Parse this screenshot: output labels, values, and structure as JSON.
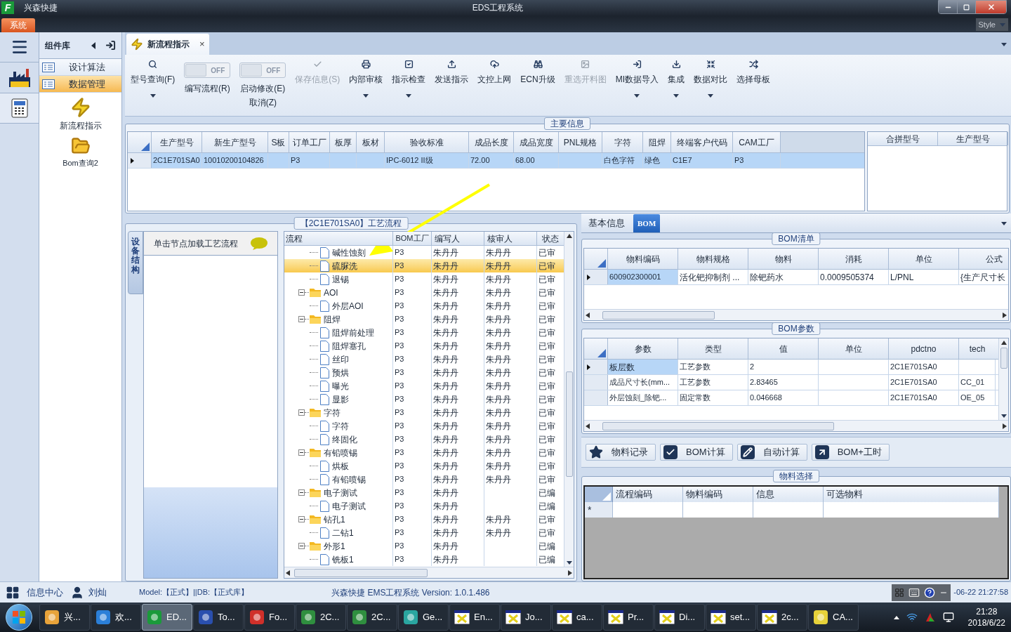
{
  "app": {
    "logo": "F",
    "name": "兴森快捷",
    "title": "EDS工程系统",
    "menu_tab": "系统",
    "style_label": "Style"
  },
  "sidebar": {
    "title": "组件库",
    "items": [
      {
        "label": "设计算法",
        "selected": false
      },
      {
        "label": "数据管理",
        "selected": true
      }
    ],
    "shortcuts": [
      {
        "label": "新流程指示"
      },
      {
        "label": "Bom查询2"
      }
    ]
  },
  "document_tab": {
    "label": "新流程指示",
    "close": "×",
    "selected": true
  },
  "toolbar": [
    {
      "kind": "button",
      "label": "型号查询(F)",
      "dropdown": true,
      "disabled": false
    },
    {
      "kind": "toggle",
      "switch_text": "OFF",
      "on": false,
      "label": "编写流程(R)"
    },
    {
      "kind": "toggle",
      "switch_text": "OFF",
      "on": false,
      "label": "启动修改(E)",
      "label_2": "取消(Z)"
    },
    {
      "kind": "button",
      "label": "保存信息(S)",
      "dropdown": false,
      "disabled": true
    },
    {
      "kind": "button",
      "label": "内部审核",
      "dropdown": true,
      "disabled": false
    },
    {
      "kind": "button",
      "label": "指示检查",
      "dropdown": true,
      "disabled": false
    },
    {
      "kind": "button",
      "label": "发送指示",
      "dropdown": false,
      "disabled": false
    },
    {
      "kind": "button",
      "label": "文控上网",
      "dropdown": false,
      "disabled": false
    },
    {
      "kind": "button",
      "label": "ECN升级",
      "dropdown": false,
      "disabled": false
    },
    {
      "kind": "button",
      "label": "重选开料图",
      "dropdown": false,
      "disabled": true
    },
    {
      "kind": "button",
      "label": "MI数据导入",
      "dropdown": true,
      "disabled": false
    },
    {
      "kind": "button",
      "label": "集成",
      "dropdown": true,
      "disabled": false
    },
    {
      "kind": "button",
      "label": "数据对比",
      "dropdown": true,
      "disabled": false
    },
    {
      "kind": "button",
      "label": "选择母板",
      "dropdown": false,
      "disabled": false
    }
  ],
  "main_info": {
    "title": "主要信息",
    "columns": [
      "生产型号",
      "新生产型号",
      "S板",
      "订单工厂",
      "板厚",
      "板材",
      "验收标准",
      "成品长度",
      "成品宽度",
      "PNL规格",
      "字符",
      "阻焊",
      "终端客户代码",
      "CAM工厂"
    ],
    "rows": [
      {
        "selected": true,
        "cells": [
          "2C1E701SA0",
          "10010200104826",
          "",
          "P3",
          "",
          "",
          "IPC-6012 II级",
          "72.00",
          "68.00",
          "",
          "白色字符",
          "绿色",
          "C1E7",
          "P3"
        ]
      }
    ],
    "side_columns": [
      "合拼型号",
      "生产型号"
    ]
  },
  "process_flow": {
    "title": "【2C1E701SA0】工艺流程",
    "side_tab": "设备结构",
    "panel_title": "单击节点加载工艺流程",
    "columns": [
      "流程",
      "BOM工厂",
      "编写人",
      "核审人",
      "状态"
    ],
    "tree": [
      {
        "kind": "file",
        "name": "碱性蚀刻",
        "factory": "P3",
        "writer": "朱丹丹",
        "reviewer": "朱丹丹",
        "status": "已审",
        "selected": false
      },
      {
        "kind": "file",
        "name": "硫脲洗",
        "factory": "P3",
        "writer": "朱丹丹",
        "reviewer": "朱丹丹",
        "status": "已审",
        "selected": true
      },
      {
        "kind": "file",
        "name": "退锡",
        "factory": "P3",
        "writer": "朱丹丹",
        "reviewer": "朱丹丹",
        "status": "已审",
        "selected": false
      },
      {
        "kind": "folder",
        "name": "AOI",
        "factory": "P3",
        "writer": "朱丹丹",
        "reviewer": "朱丹丹",
        "status": "已审",
        "selected": false,
        "expanded": true,
        "children": [
          {
            "kind": "file",
            "name": "外层AOI",
            "factory": "P3",
            "writer": "朱丹丹",
            "reviewer": "朱丹丹",
            "status": "已审",
            "selected": false
          }
        ]
      },
      {
        "kind": "folder",
        "name": "阻焊",
        "factory": "P3",
        "writer": "朱丹丹",
        "reviewer": "朱丹丹",
        "status": "已审",
        "selected": false,
        "expanded": true,
        "children": [
          {
            "kind": "file",
            "name": "阻焊前处理",
            "factory": "P3",
            "writer": "朱丹丹",
            "reviewer": "朱丹丹",
            "status": "已审",
            "selected": false
          },
          {
            "kind": "file",
            "name": "阻焊塞孔",
            "factory": "P3",
            "writer": "朱丹丹",
            "reviewer": "朱丹丹",
            "status": "已审",
            "selected": false
          },
          {
            "kind": "file",
            "name": "丝印",
            "factory": "P3",
            "writer": "朱丹丹",
            "reviewer": "朱丹丹",
            "status": "已审",
            "selected": false
          },
          {
            "kind": "file",
            "name": "预烘",
            "factory": "P3",
            "writer": "朱丹丹",
            "reviewer": "朱丹丹",
            "status": "已审",
            "selected": false
          },
          {
            "kind": "file",
            "name": "曝光",
            "factory": "P3",
            "writer": "朱丹丹",
            "reviewer": "朱丹丹",
            "status": "已审",
            "selected": false
          },
          {
            "kind": "file",
            "name": "显影",
            "factory": "P3",
            "writer": "朱丹丹",
            "reviewer": "朱丹丹",
            "status": "已审",
            "selected": false
          }
        ]
      },
      {
        "kind": "folder",
        "name": "字符",
        "factory": "P3",
        "writer": "朱丹丹",
        "reviewer": "朱丹丹",
        "status": "已审",
        "selected": false,
        "expanded": true,
        "children": [
          {
            "kind": "file",
            "name": "字符",
            "factory": "P3",
            "writer": "朱丹丹",
            "reviewer": "朱丹丹",
            "status": "已审",
            "selected": false
          },
          {
            "kind": "file",
            "name": "终固化",
            "factory": "P3",
            "writer": "朱丹丹",
            "reviewer": "朱丹丹",
            "status": "已审",
            "selected": false
          }
        ]
      },
      {
        "kind": "folder",
        "name": "有铅喷锡",
        "factory": "P3",
        "writer": "朱丹丹",
        "reviewer": "朱丹丹",
        "status": "已审",
        "selected": false,
        "expanded": true,
        "children": [
          {
            "kind": "file",
            "name": "烘板",
            "factory": "P3",
            "writer": "朱丹丹",
            "reviewer": "朱丹丹",
            "status": "已审",
            "selected": false
          },
          {
            "kind": "file",
            "name": "有铅喷锡",
            "factory": "P3",
            "writer": "朱丹丹",
            "reviewer": "朱丹丹",
            "status": "已审",
            "selected": false
          }
        ]
      },
      {
        "kind": "folder",
        "name": "电子测试",
        "factory": "P3",
        "writer": "朱丹丹",
        "status": "已编",
        "selected": false,
        "expanded": true,
        "children": [
          {
            "kind": "file",
            "name": "电子测试",
            "factory": "P3",
            "writer": "朱丹丹",
            "status": "已编",
            "selected": false
          }
        ]
      },
      {
        "kind": "folder",
        "name": "钻孔1",
        "factory": "P3",
        "writer": "朱丹丹",
        "reviewer": "朱丹丹",
        "status": "已审",
        "selected": false,
        "expanded": true,
        "children": [
          {
            "kind": "file",
            "name": "二钻1",
            "factory": "P3",
            "writer": "朱丹丹",
            "reviewer": "朱丹丹",
            "status": "已审",
            "selected": false
          }
        ]
      },
      {
        "kind": "folder",
        "name": "外形1",
        "factory": "P3",
        "writer": "朱丹丹",
        "status": "已编",
        "selected": false,
        "expanded": true,
        "children": [
          {
            "kind": "file",
            "name": "铣板1",
            "factory": "P3",
            "writer": "朱丹丹",
            "status": "已编",
            "selected": false
          }
        ]
      }
    ]
  },
  "detail_tabs": [
    {
      "label": "基本信息",
      "selected": false
    },
    {
      "label": "BOM",
      "selected": true
    }
  ],
  "bom_list": {
    "title": "BOM清单",
    "columns": [
      "物料编码",
      "物料规格",
      "物料",
      "消耗",
      "单位",
      "公式"
    ],
    "rows": [
      {
        "cells": [
          "600902300001",
          "活化钯抑制剂 ...",
          "除钯药水",
          "0.0009505374",
          "L/PNL",
          "{生产尺寸长"
        ]
      }
    ]
  },
  "bom_params": {
    "title": "BOM参数",
    "columns": [
      "参数",
      "类型",
      "值",
      "单位",
      "pdctno",
      "tech"
    ],
    "rows": [
      {
        "cells": [
          "板层数",
          "工艺参数",
          "2",
          "",
          "2C1E701SA0",
          ""
        ]
      },
      {
        "cells": [
          "成品尺寸长(mm...",
          "工艺参数",
          "2.83465",
          "",
          "2C1E701SA0",
          "CC_01"
        ]
      },
      {
        "cells": [
          "外层蚀刻_除钯...",
          "固定常数",
          "0.046668",
          "",
          "2C1E701SA0",
          "OE_05"
        ]
      }
    ]
  },
  "actions": [
    "物料记录",
    "BOM计算",
    "自动计算",
    "BOM+工时"
  ],
  "material_select": {
    "title": "物料选择",
    "columns": [
      "流程编码",
      "物料编码",
      "信息",
      "可选物料"
    ],
    "new_row_marker": "*"
  },
  "status_bar": {
    "info": "信息中心",
    "user": "刘灿",
    "model": "Model:【正式】||DB:【正式库】",
    "version": "兴森快捷 EMS工程系统 Version: 1.0.1.486",
    "datetime": "-06-22 21:27:58"
  },
  "taskbar": {
    "items": [
      {
        "label": "兴...",
        "selected": false
      },
      {
        "label": "欢...",
        "selected": false
      },
      {
        "label": "ED...",
        "selected": true
      },
      {
        "label": "To...",
        "selected": false
      },
      {
        "label": "Fo...",
        "selected": false
      },
      {
        "label": "2C...",
        "selected": false
      },
      {
        "label": "2C...",
        "selected": false
      },
      {
        "label": "Ge...",
        "selected": false
      },
      {
        "label": "En...",
        "selected": false
      },
      {
        "label": "Jo...",
        "selected": false
      },
      {
        "label": "ca...",
        "selected": false
      },
      {
        "label": "Pr...",
        "selected": false
      },
      {
        "label": "Di...",
        "selected": false
      },
      {
        "label": "set...",
        "selected": false
      },
      {
        "label": "2c...",
        "selected": false
      },
      {
        "label": "CA...",
        "selected": false
      }
    ],
    "time": "21:28",
    "date": "2018/6/22"
  }
}
